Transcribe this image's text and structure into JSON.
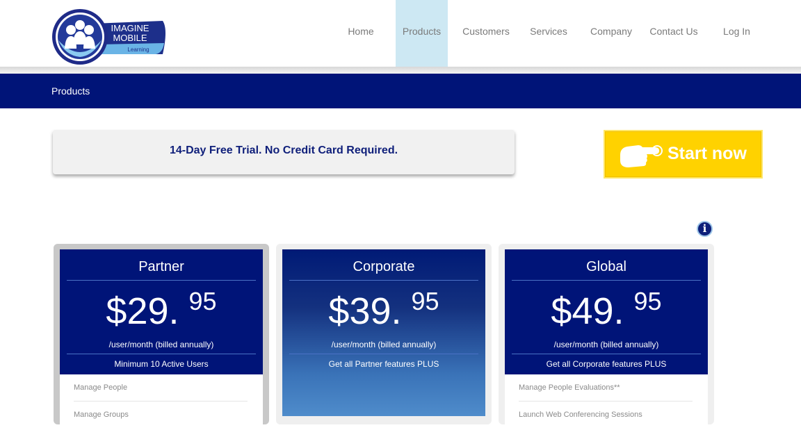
{
  "header": {
    "logo": {
      "line1": "IMAGINE",
      "line2": "MOBILE",
      "line3": "Learning"
    },
    "nav": [
      {
        "label": "Home"
      },
      {
        "label": "Products",
        "active": true
      },
      {
        "label": "Customers"
      },
      {
        "label": "Services"
      },
      {
        "label": "Company"
      },
      {
        "label": "Contact Us"
      },
      {
        "label": "Log In"
      }
    ]
  },
  "band": {
    "title": "Products"
  },
  "trial": {
    "text": "14-Day Free Trial. No Credit Card Required."
  },
  "cta": {
    "label": "Start now",
    "icon": "pointing-hand-icon"
  },
  "info_icon": "info-icon",
  "plans": [
    {
      "name": "Partner",
      "price_main": "$29.",
      "price_cents": "95",
      "billing": "/user/month (billed annually)",
      "note": "Minimum 10 Active Users",
      "features": [
        "Manage People",
        "Manage Groups"
      ]
    },
    {
      "name": "Corporate",
      "price_main": "$39.",
      "price_cents": "95",
      "billing": "/user/month (billed annually)",
      "note": "Get all Partner features PLUS",
      "features": []
    },
    {
      "name": "Global",
      "price_main": "$49.",
      "price_cents": "95",
      "billing": "/user/month (billed annually)",
      "note": "Get all Corporate features PLUS",
      "features": [
        "Manage People Evaluations**",
        "Launch Web Conferencing Sessions"
      ]
    }
  ],
  "colors": {
    "brand_navy": "#001478",
    "nav_active_bg": "#cde8f3",
    "cta_yellow": "#ffd200",
    "trial_text": "#0f1f7a"
  }
}
